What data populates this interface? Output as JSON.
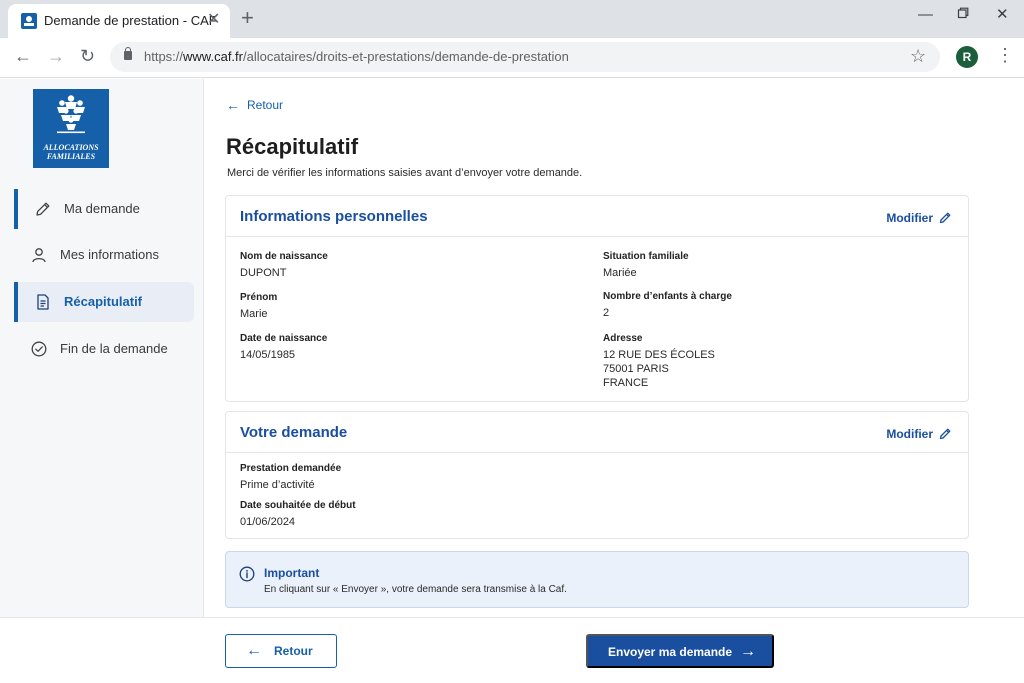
{
  "browser": {
    "tab_title": "Demande de prestation - CAF",
    "tab_close": "✕",
    "new_tab": "+",
    "url_prefix": "https://",
    "url_host": "www.caf.fr",
    "url_path": "/allocataires/droits-et-prestations/demande-de-prestation",
    "profile_initial": "R",
    "icons": [
      "back-icon",
      "forward-icon",
      "reload-icon",
      "lock-icon",
      "star-icon",
      "kebab-menu-icon",
      "minimize-icon",
      "restore-icon",
      "close-window-icon"
    ]
  },
  "sidebar": {
    "logo_text": "ALLOCATIONS FAMILIALES",
    "items": [
      {
        "label": "Ma demande",
        "icon": "pencil-icon"
      },
      {
        "label": "Mes informations",
        "icon": "user-icon"
      },
      {
        "label": "Récapitulatif",
        "icon": "document-icon"
      },
      {
        "label": "Fin de la demande",
        "icon": "check-circle-icon"
      }
    ]
  },
  "main": {
    "back_label": "Retour",
    "title": "Récapitulatif",
    "subtitle": "Merci de vérifier les informations saisies avant d’envoyer votre demande.",
    "personal": {
      "title": "Informations personnelles",
      "modify_label": "Modifier",
      "fields": {
        "birth_name_label": "Nom de naissance",
        "birth_name": "DUPONT",
        "first_name_label": "Prénom",
        "first_name": "Marie",
        "birth_date_label": "Date de naissance",
        "birth_date": "14/05/1985",
        "family_label": "Situation familiale",
        "family": "Mariée",
        "children_label": "Nombre d’enfants à charge",
        "children": "2",
        "address_label": "Adresse",
        "address_line1": "12 RUE DES ÉCOLES",
        "address_line2": "75001 PARIS",
        "address_line3": "FRANCE"
      }
    },
    "request": {
      "title": "Votre demande",
      "modify_label": "Modifier",
      "fields": {
        "benefit_label": "Prestation demandée",
        "benefit": "Prime d’activité",
        "start_label": "Date souhaitée de début",
        "start": "01/06/2024"
      }
    },
    "notice": {
      "title": "Important",
      "text": "En cliquant sur « Envoyer », votre demande sera transmise à la Caf."
    }
  },
  "footer": {
    "back_label": "Retour",
    "submit_label": "Envoyer ma demande"
  },
  "colors": {
    "brand_blue": "#1560a8",
    "title_blue": "#1a4fa0",
    "sidebar_bg": "#f6f7f9",
    "notice_bg": "#eaf1fa"
  }
}
